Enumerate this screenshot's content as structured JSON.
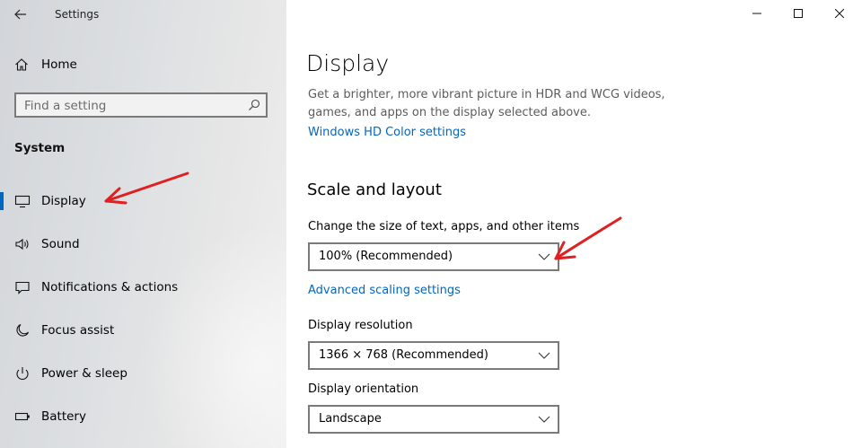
{
  "window": {
    "app_title": "Settings",
    "controls": [
      "minimize",
      "maximize",
      "close"
    ]
  },
  "sidebar": {
    "home_label": "Home",
    "search_placeholder": "Find a setting",
    "section_label": "System",
    "items": [
      {
        "label": "Display",
        "icon": "monitor-icon",
        "active": true
      },
      {
        "label": "Sound",
        "icon": "speaker-icon",
        "active": false
      },
      {
        "label": "Notifications & actions",
        "icon": "notification-icon",
        "active": false
      },
      {
        "label": "Focus assist",
        "icon": "moon-icon",
        "active": false
      },
      {
        "label": "Power & sleep",
        "icon": "power-icon",
        "active": false
      },
      {
        "label": "Battery",
        "icon": "battery-icon",
        "active": false
      }
    ]
  },
  "main": {
    "title": "Display",
    "hdr_description": "Get a brighter, more vibrant picture in HDR and WCG videos, games, and apps on the display selected above.",
    "hdr_link": "Windows HD Color settings",
    "scale_section_title": "Scale and layout",
    "scale_label": "Change the size of text, apps, and other items",
    "scale_value": "100% (Recommended)",
    "advanced_scaling_link": "Advanced scaling settings",
    "resolution_label": "Display resolution",
    "resolution_value": "1366 × 768 (Recommended)",
    "orientation_label": "Display orientation",
    "orientation_value": "Landscape"
  },
  "colors": {
    "accent": "#0067c0",
    "annotation_arrow": "#e02020"
  }
}
